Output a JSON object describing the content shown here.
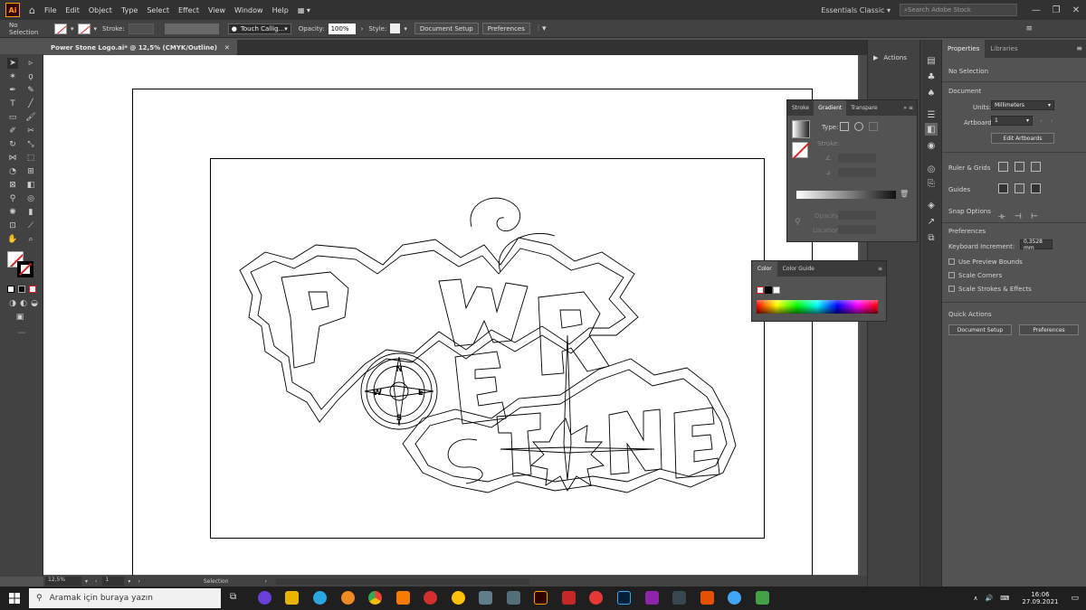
{
  "menubar": {
    "app_logo": "Ai",
    "items": [
      "File",
      "Edit",
      "Object",
      "Type",
      "Select",
      "Effect",
      "View",
      "Window",
      "Help"
    ],
    "workspace": "Essentials Classic",
    "search_placeholder": "Search Adobe Stock"
  },
  "control_bar": {
    "selection": "No Selection",
    "stroke_label": "Stroke:",
    "brush": "Touch Callig...",
    "opacity_label": "Opacity:",
    "opacity_value": "100%",
    "style_label": "Style:",
    "document_setup": "Document Setup",
    "preferences": "Preferences"
  },
  "document": {
    "tab_title": "Power Stone Logo.ai* @ 12,5% (CMYK/Outline)"
  },
  "status_bar": {
    "zoom": "12,5%",
    "artboard": "1",
    "tool": "Selection"
  },
  "dock": {
    "actions_label": "Actions"
  },
  "properties_panel": {
    "tab_properties": "Properties",
    "tab_libraries": "Libraries",
    "no_selection": "No Selection",
    "document_header": "Document",
    "units_label": "Units:",
    "units_value": "Millimeters",
    "artboard_label": "Artboard:",
    "artboard_value": "1",
    "edit_artboards": "Edit Artboards",
    "ruler_grids": "Ruler & Grids",
    "guides": "Guides",
    "snap_options": "Snap Options",
    "preferences_header": "Preferences",
    "keyboard_increment_label": "Keyboard Increment:",
    "keyboard_increment_value": "0,3528 mm",
    "use_preview_bounds": "Use Preview Bounds",
    "scale_corners": "Scale Corners",
    "scale_strokes": "Scale Strokes & Effects",
    "quick_actions": "Quick Actions",
    "document_setup": "Document Setup",
    "preferences": "Preferences"
  },
  "gradient_panel": {
    "tab_stroke": "Stroke",
    "tab_gradient": "Gradient",
    "tab_transparency": "Transpare",
    "type_label": "Type:",
    "stroke_label": "Stroke:",
    "opacity_label": "Opacity:",
    "location_label": "Location:"
  },
  "color_panel": {
    "tab_color": "Color",
    "tab_color_guide": "Color Guide"
  },
  "artwork": {
    "compass_n": "N",
    "compass_w": "W",
    "compass_e": "E",
    "compass_s": "S"
  },
  "taskbar": {
    "search_placeholder": "Aramak için buraya yazın",
    "time": "16:06",
    "date": "27.09.2021"
  }
}
